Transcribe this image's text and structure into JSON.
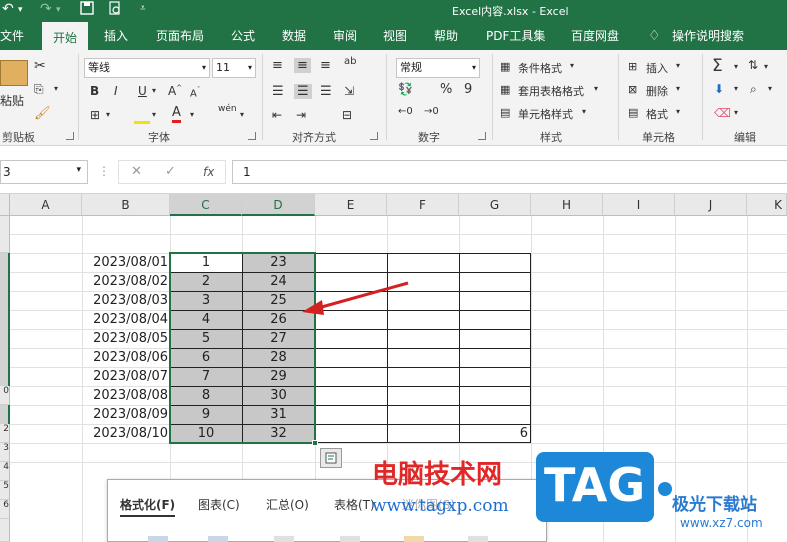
{
  "app": {
    "title": "Excel内容.xlsx  -  Excel"
  },
  "menu": {
    "tabs": [
      "文件",
      "开始",
      "插入",
      "页面布局",
      "公式",
      "数据",
      "审阅",
      "视图",
      "帮助",
      "PDF工具集",
      "百度网盘"
    ],
    "active": "开始",
    "tell_me": "操作说明搜索"
  },
  "ribbon": {
    "paste_label": "粘贴",
    "font_name": "等线",
    "font_size": "11",
    "bold": "B",
    "italic": "I",
    "underline": "U",
    "number_format": "常规",
    "percent": "%",
    "thousands": "9",
    "styles": {
      "conditional": "条件格式",
      "table": "套用表格格式",
      "cell": "单元格样式"
    },
    "cells": {
      "insert": "插入",
      "delete": "删除",
      "format": "格式"
    },
    "groups": {
      "clipboard": "剪贴板",
      "font": "字体",
      "alignment": "对齐方式",
      "number": "数字",
      "styles": "样式",
      "cells": "单元格",
      "editing": "编辑"
    }
  },
  "formula_bar": {
    "name_box": "3",
    "fx": "fx",
    "value": "1"
  },
  "columns": [
    "A",
    "B",
    "C",
    "D",
    "E",
    "F",
    "G",
    "H",
    "I",
    "J",
    "K"
  ],
  "rows_visible_numbers": [
    "0",
    "2",
    "3",
    "4",
    "5",
    "6"
  ],
  "table": {
    "dates": [
      "2023/08/01",
      "2023/08/02",
      "2023/08/03",
      "2023/08/04",
      "2023/08/05",
      "2023/08/06",
      "2023/08/07",
      "2023/08/08",
      "2023/08/09",
      "2023/08/10"
    ],
    "col_c": [
      "1",
      "2",
      "3",
      "4",
      "5",
      "6",
      "7",
      "8",
      "9",
      "10"
    ],
    "col_d": [
      "23",
      "24",
      "25",
      "26",
      "27",
      "28",
      "29",
      "30",
      "31",
      "32"
    ],
    "g_last": "6"
  },
  "quick_analysis": {
    "tabs": [
      "格式化(F)",
      "图表(C)",
      "汇总(O)",
      "表格(T)",
      "迷你图(S)"
    ]
  },
  "watermark": {
    "site_cn": "电脑技术网",
    "site_url": "www.tagxp.com",
    "tag_logo": "TAG",
    "right_cn": "极光下载站",
    "right_url": "www.xz7.com"
  },
  "colors": {
    "brand": "#217346",
    "arrow": "#d32020",
    "selection": "#c8c8c8",
    "tag_blue": "#1e88d8"
  }
}
